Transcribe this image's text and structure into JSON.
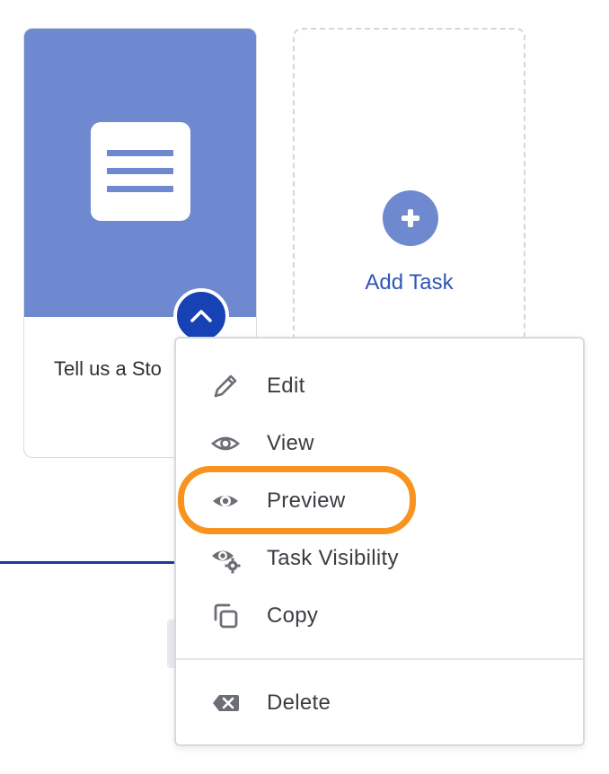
{
  "task_card": {
    "title": "Tell us a Sto",
    "header_color": "#6e89d0",
    "icon": "document-lines-icon",
    "toggle_icon": "chevron-up-icon"
  },
  "add_card": {
    "label": "Add Task",
    "icon": "plus-icon"
  },
  "menu": {
    "items": [
      {
        "label": "Edit",
        "icon": "pencil-icon"
      },
      {
        "label": "View",
        "icon": "eye-icon"
      },
      {
        "label": "Preview",
        "icon": "eye-icon",
        "highlighted": true
      },
      {
        "label": "Task Visibility",
        "icon": "eye-gear-icon"
      },
      {
        "label": "Copy",
        "icon": "copy-icon"
      },
      {
        "label": "Delete",
        "icon": "delete-icon"
      }
    ]
  },
  "colors": {
    "accent": "#6e89d0",
    "primary": "#1742b6",
    "highlight": "#f7931e",
    "link": "#2f56b6"
  }
}
